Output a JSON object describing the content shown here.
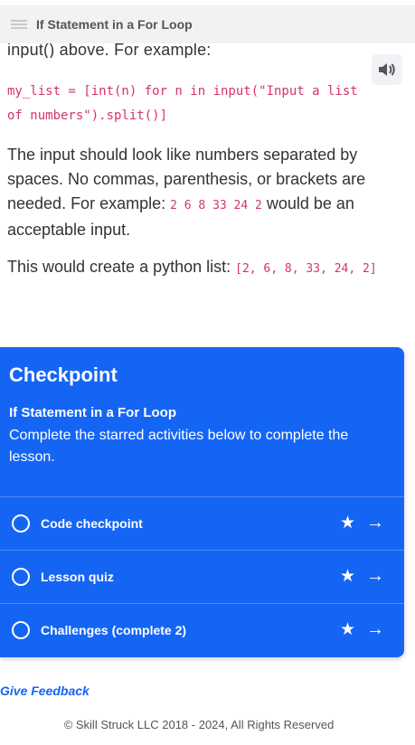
{
  "header": {
    "title": "If Statement in a For Loop"
  },
  "lesson": {
    "cut_text": "input() above.  For example:",
    "code_line_1": "my_list = [int(n) for n in input(\"Input a list",
    "code_line_2": "of numbers\").split()]",
    "para1_text": "The input should look like numbers separated by spaces.  No commas, parenthesis, or brackets are needed.  For example: ",
    "para1_code": "2 6 8 33 24 2",
    "para1_end": " would be an acceptable input.",
    "para2_text": "This would create a python list: ",
    "para2_code": "[2, 6, 8, 33, 24, 2]"
  },
  "checkpoint": {
    "heading": "Checkpoint",
    "subtitle": "If Statement in a For Loop",
    "description": "Complete the starred activities below to complete the lesson.",
    "items": [
      {
        "label": "Code checkpoint"
      },
      {
        "label": "Lesson quiz"
      },
      {
        "label": "Challenges (complete 2)"
      }
    ],
    "accent_color": "#1565f5"
  },
  "feedback_label": "Give Feedback",
  "footer": {
    "copyright": "© Skill Struck LLC 2018 - 2024, All Rights Reserved"
  }
}
